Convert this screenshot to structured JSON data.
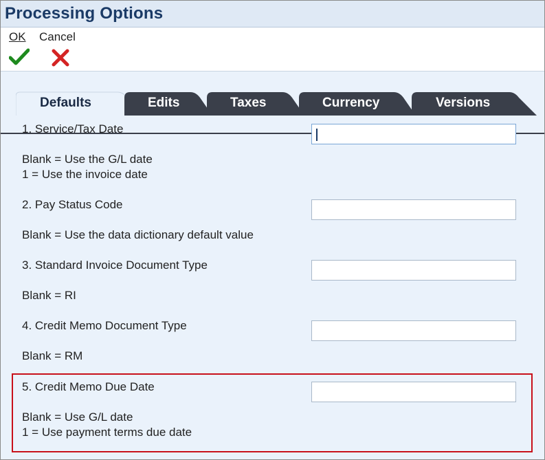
{
  "window": {
    "title": "Processing Options"
  },
  "toolbar": {
    "ok_label": "OK",
    "cancel_label": "Cancel",
    "ok_icon": "checkmark-icon",
    "cancel_icon": "x-icon",
    "ok_color": "#1e8a1e",
    "cancel_color": "#d42424"
  },
  "tabs": [
    {
      "label": "Defaults",
      "active": true
    },
    {
      "label": "Edits",
      "active": false
    },
    {
      "label": "Taxes",
      "active": false
    },
    {
      "label": "Currency",
      "active": false
    },
    {
      "label": "Versions",
      "active": false
    }
  ],
  "options": [
    {
      "label": "1. Service/Tax Date",
      "help": [
        "Blank = Use the G/L date",
        "1 = Use the invoice date"
      ],
      "value": "",
      "focused": true
    },
    {
      "label": "2. Pay Status Code",
      "help": [
        "Blank = Use the data dictionary default value"
      ],
      "value": ""
    },
    {
      "label": "3. Standard Invoice Document Type",
      "help": [
        "Blank = RI"
      ],
      "value": ""
    },
    {
      "label": "4. Credit Memo Document Type",
      "help": [
        "Blank = RM"
      ],
      "value": ""
    },
    {
      "label": "5. Credit Memo Due Date",
      "help": [
        "Blank = Use G/L date",
        "1 = Use payment terms due date"
      ],
      "value": "",
      "highlighted": true
    }
  ],
  "colors": {
    "highlight_border": "#c8101a",
    "title_text": "#1a3a66",
    "tab_dark": "#3a3f4a"
  }
}
